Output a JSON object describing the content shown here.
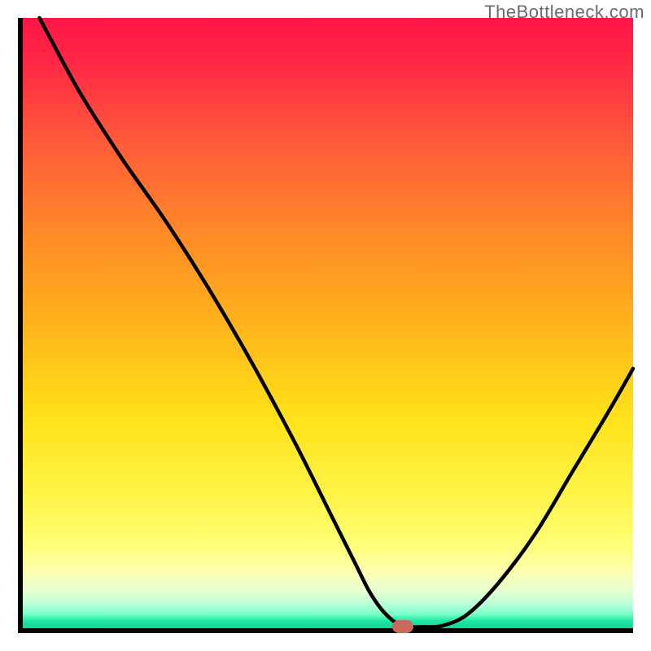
{
  "watermark_text": "TheBottleneck.com",
  "chart_data": {
    "type": "line",
    "title": "",
    "xlabel": "",
    "ylabel": "",
    "x_range": [
      0,
      100
    ],
    "y_range": [
      0,
      100
    ],
    "grid": false,
    "legend": "none",
    "series": [
      {
        "name": "curve",
        "x": [
          3.5,
          10,
          17,
          24,
          31,
          38,
          45,
          51,
          54.5,
          57,
          59,
          61,
          62.5,
          64,
          66,
          69,
          73,
          78,
          84,
          90,
          96,
          100
        ],
        "y": [
          100,
          88,
          77,
          67,
          56,
          44,
          31,
          19,
          12,
          7,
          4,
          2,
          1.3,
          1,
          1,
          1.2,
          3,
          8,
          16,
          26,
          36,
          43
        ]
      }
    ],
    "annotations": [
      {
        "type": "marker",
        "shape": "rounded-rect",
        "color": "#c96a5e",
        "x": 62.5,
        "y": 1
      }
    ],
    "background_gradient": {
      "direction": "vertical",
      "stops": [
        {
          "pos": 0.0,
          "color": "#ff1548"
        },
        {
          "pos": 0.35,
          "color": "#ff8a28"
        },
        {
          "pos": 0.65,
          "color": "#ffe21a"
        },
        {
          "pos": 0.9,
          "color": "#fdffaf"
        },
        {
          "pos": 0.98,
          "color": "#20e8a3"
        },
        {
          "pos": 1.0,
          "color": "#12d196"
        }
      ]
    }
  },
  "colors": {
    "axis": "#000000",
    "curve": "#000000",
    "marker": "#c96a5e",
    "watermark": "#6b6b6b"
  }
}
